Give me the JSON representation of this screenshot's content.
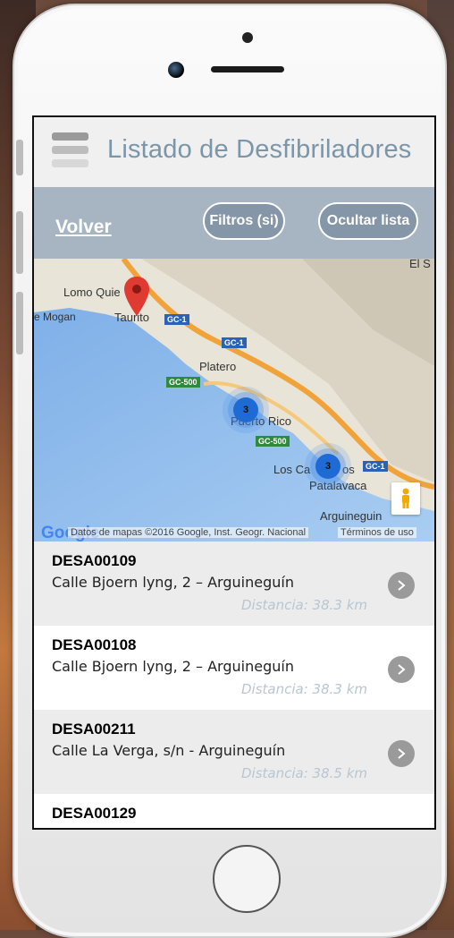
{
  "header": {
    "title": "Listado de Desfibriladores"
  },
  "toolbar": {
    "back_label": "Volver",
    "filters_label": "Filtros (si)",
    "hide_list_label": "Ocultar lista"
  },
  "map": {
    "places": {
      "lomo_quemado": "Lomo Quie",
      "mogan": "e Mogan",
      "taurito": "Taurito",
      "platero": "Platero",
      "puerto_rico": "Puerto Rico",
      "los_canos": "Los Ca",
      "los_canos_suffix": "os",
      "patalavaca": "Patalavaca",
      "arguineguin": "Arguineguin",
      "corner_label": "El S"
    },
    "roads": {
      "gc1_a": "GC-1",
      "gc1_b": "GC-1",
      "gc1_c": "GC-1",
      "gc500_a": "GC-500",
      "gc500_b": "GC-500"
    },
    "clusters": [
      "3",
      "3"
    ],
    "google_logo": "Google",
    "attribution": "Datos de mapas ©2016 Google, Inst. Geogr. Nacional",
    "terms": "Términos de uso"
  },
  "items": [
    {
      "code": "DESA00109",
      "address": "Calle Bjoern lyng, 2 – Arguineguín",
      "distance": "Distancia: 38.3 km"
    },
    {
      "code": "DESA00108",
      "address": "Calle Bjoern lyng, 2 – Arguineguín",
      "distance": "Distancia: 38.3 km"
    },
    {
      "code": "DESA00211",
      "address": "Calle La Verga, s/n - Arguineguín",
      "distance": "Distancia: 38.5 km"
    },
    {
      "code": "DESA00129",
      "address": "",
      "distance": ""
    }
  ],
  "colors": {
    "title": "#7b95a9",
    "toolbar": "#a7b5c3",
    "button": "#8496a8",
    "distance": "#b8c6d2"
  }
}
